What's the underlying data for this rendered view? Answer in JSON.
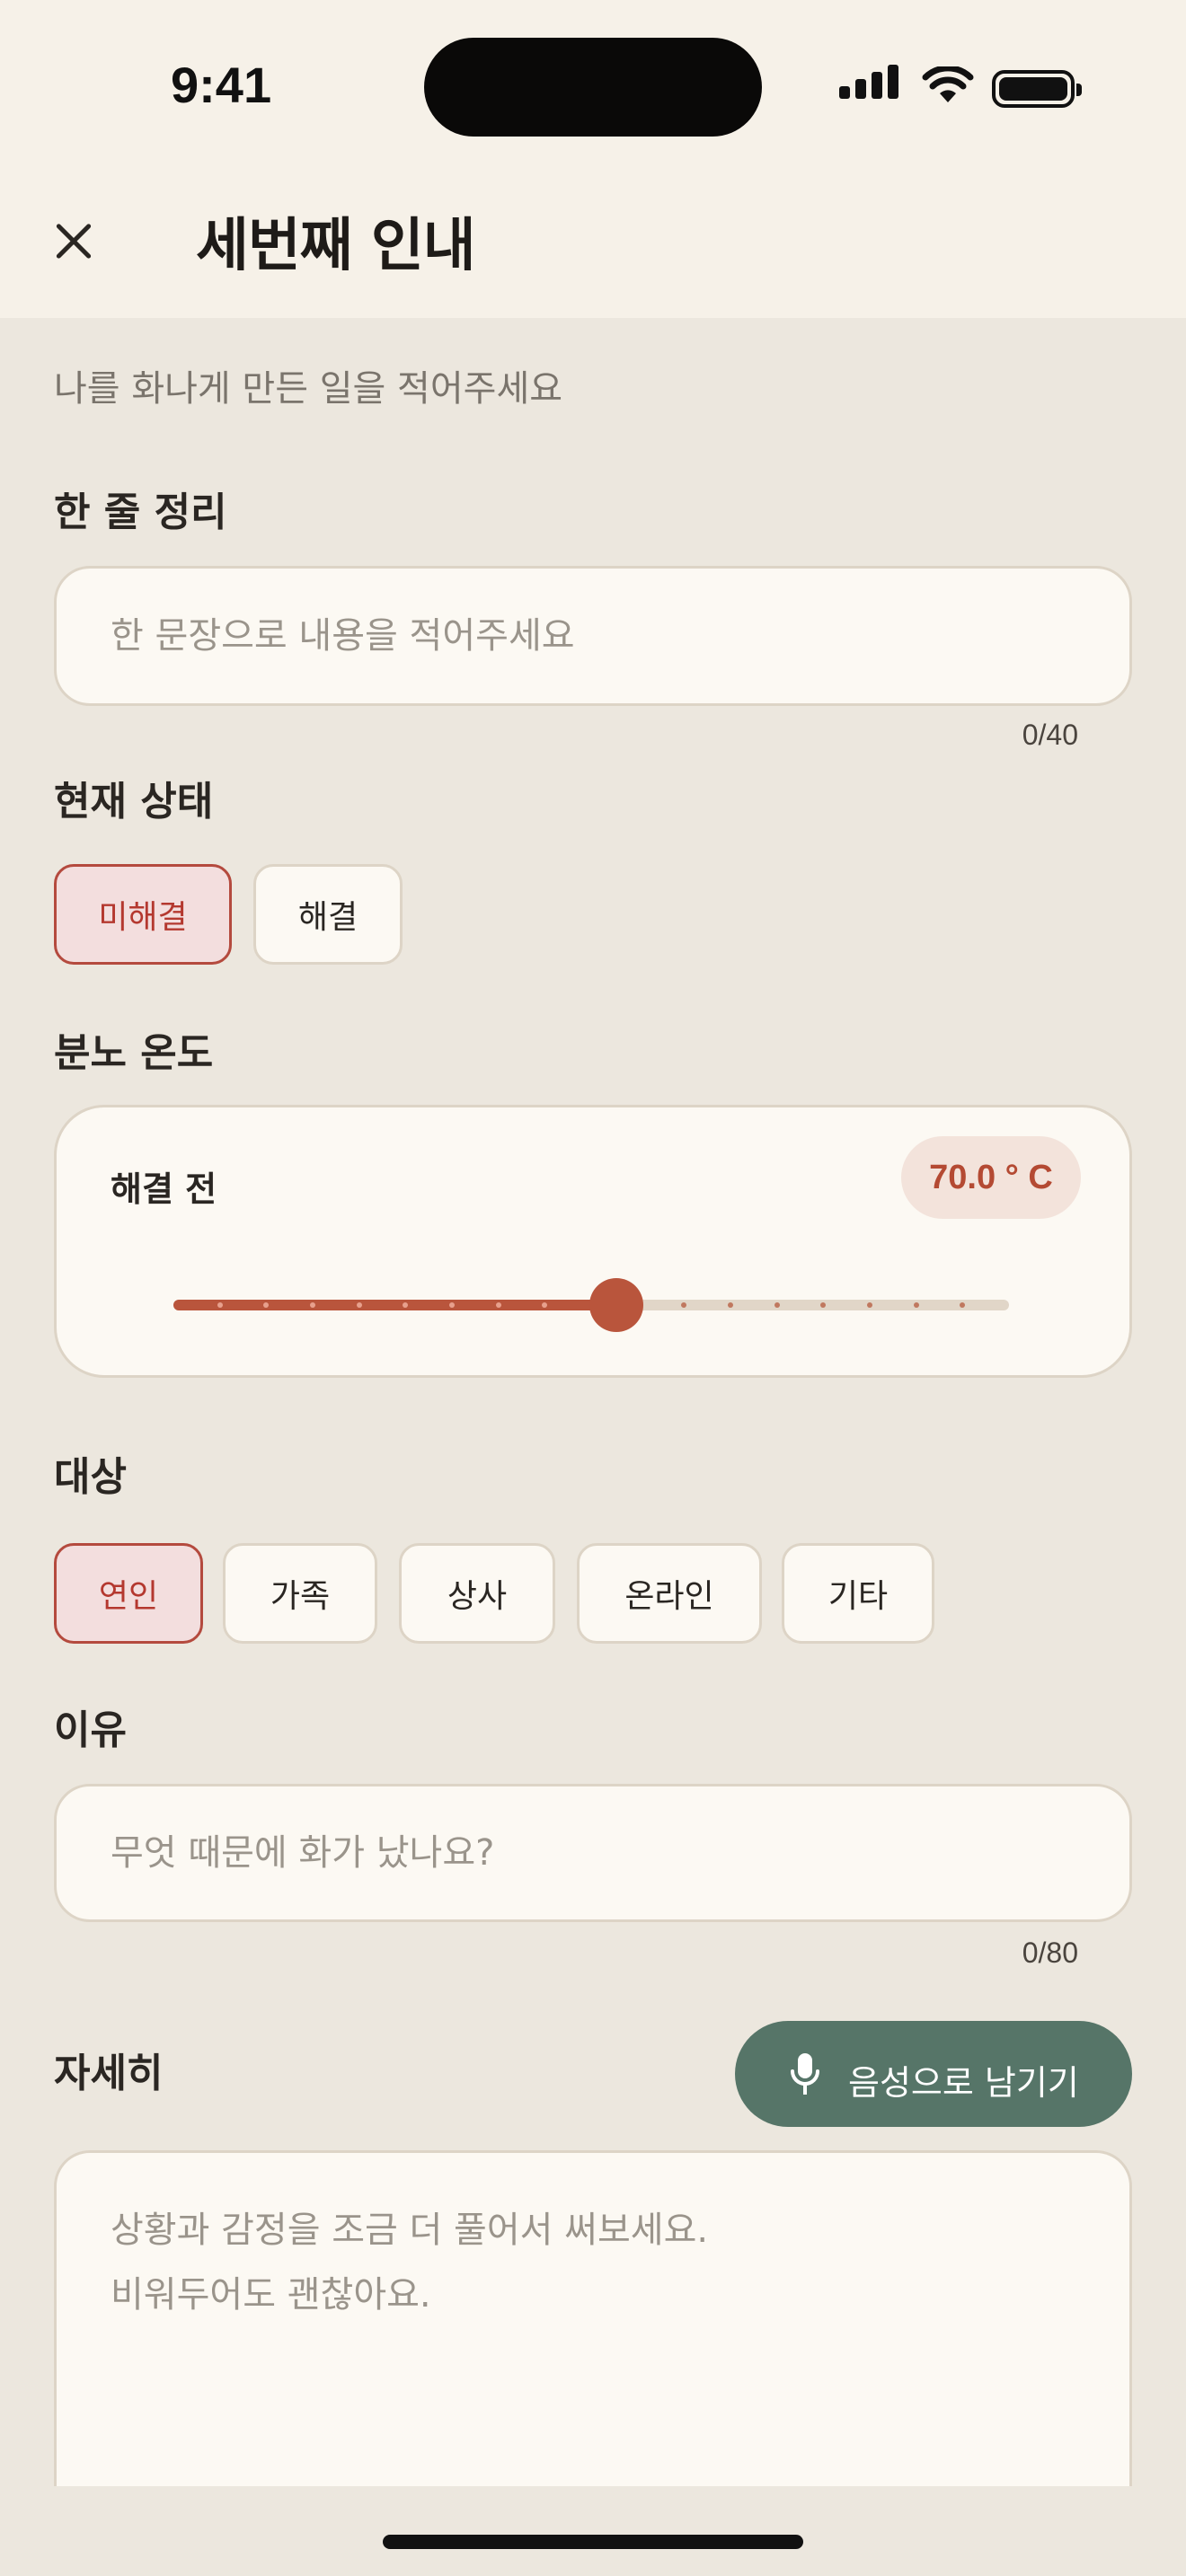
{
  "status_bar": {
    "time": "9:41"
  },
  "header": {
    "title": "세번째 인내"
  },
  "subtitle": "나를 화나게 만든 일을 적어주세요",
  "summary": {
    "label": "한 줄 정리",
    "placeholder": "한 문장으로 내용을 적어주세요",
    "counter": "0/40"
  },
  "status_section": {
    "label": "현재 상태",
    "options": [
      "미해결",
      "해결"
    ],
    "selected": "미해결"
  },
  "anger": {
    "label": "분노 온도",
    "card_label": "해결 전",
    "value_display": "70.0 ° C",
    "level": 0.53,
    "ticks": 18
  },
  "target": {
    "label": "대상",
    "options": [
      "연인",
      "가족",
      "상사",
      "온라인",
      "기타"
    ],
    "selected": "연인"
  },
  "reason": {
    "label": "이유",
    "placeholder": "무엇 때문에 화가 났나요?",
    "counter": "0/80"
  },
  "detail": {
    "label": "자세히",
    "voice_button": "음성으로 남기기",
    "placeholder": "상황과 감정을 조금 더 풀어서 써보세요.\n비워두어도 괜찮아요."
  },
  "colors": {
    "accent": "#b9553c",
    "chip_active_bg": "#f3dede",
    "voice_button": "#567568",
    "background": "#ece7de"
  }
}
